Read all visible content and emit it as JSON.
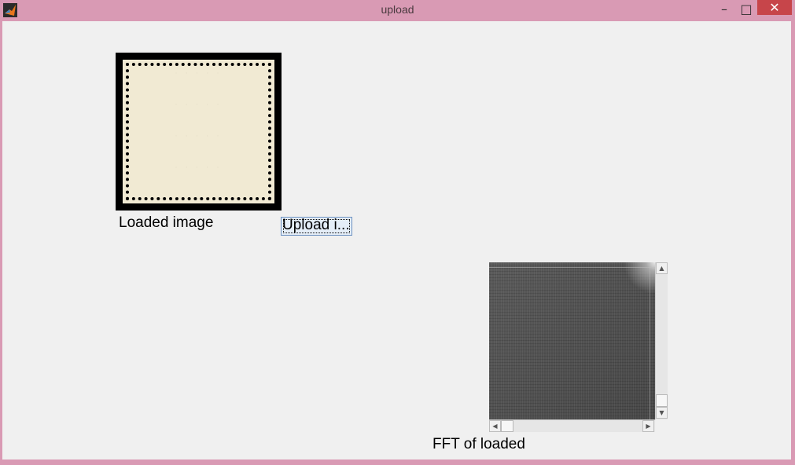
{
  "window": {
    "title": "upload",
    "controls": {
      "minimize": "–",
      "maximize": "□",
      "close": "✕"
    },
    "colors": {
      "frame": "#d99ab4",
      "client": "#f0f0f0",
      "close": "#c7454a"
    }
  },
  "icons": {
    "app": "matlab-logo-icon"
  },
  "loaded_axes": {
    "label": "Loaded image",
    "content": "postage-stamp-image"
  },
  "upload": {
    "label": "Upload i..."
  },
  "fft_axes": {
    "label": "FFT of loaded",
    "content": "fft-spectrum-image"
  },
  "scroll": {
    "up": "▲",
    "down": "▼",
    "left": "◀",
    "right": "▶"
  }
}
